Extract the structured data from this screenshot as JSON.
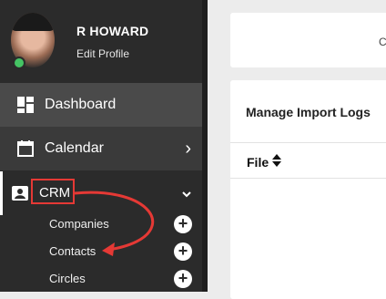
{
  "profile": {
    "name": "R HOWARD",
    "edit_label": "Edit Profile"
  },
  "nav": {
    "dashboard": "Dashboard",
    "calendar": "Calendar",
    "crm": "CRM",
    "crm_children": [
      {
        "label": "Companies"
      },
      {
        "label": "Contacts"
      },
      {
        "label": "Circles"
      }
    ]
  },
  "main": {
    "top_card_text": "C",
    "panel_title": "Manage Import Logs",
    "table": {
      "columns": [
        "File"
      ]
    }
  },
  "colors": {
    "sidebar": "#2b2b2b",
    "highlight": "#e53935",
    "online": "#45c464"
  },
  "icons": {
    "add": "+",
    "chevron_right": "›",
    "chevron_down": "⌄"
  }
}
